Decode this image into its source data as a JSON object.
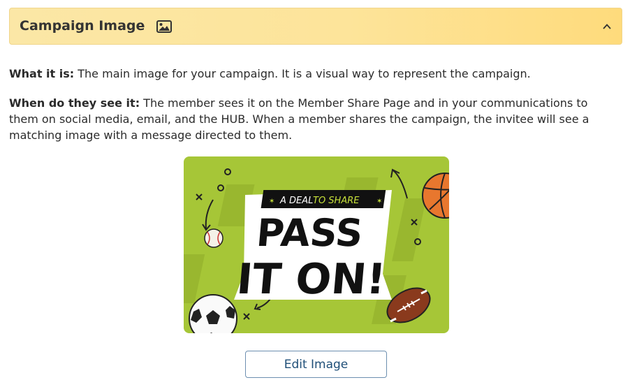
{
  "header": {
    "title": "Campaign Image",
    "title_icon": "image-icon",
    "collapse_icon": "chevron-up-icon"
  },
  "description": {
    "what_label": "What it is:",
    "what_text": " The main image for your campaign. It is a visual way to represent the campaign.",
    "when_label": "When do they see it:",
    "when_text": " The member sees it on the Member Share Page and in your communications to them on social media, email, and the HUB. When a member shares the campaign, the invitee will see a matching image with a message directed to them."
  },
  "image": {
    "banner_text": "A DEAL TO SHARE",
    "banner_prefix": "A DEAL",
    "banner_highlight": "TO SHARE",
    "headline_line1": "PASS",
    "headline_line2": "IT ON!",
    "background_color": "#a6c637",
    "highlight_color": "#c6e03a",
    "balls": [
      "basketball",
      "baseball",
      "soccer-ball",
      "football"
    ]
  },
  "actions": {
    "edit_label": "Edit Image"
  }
}
